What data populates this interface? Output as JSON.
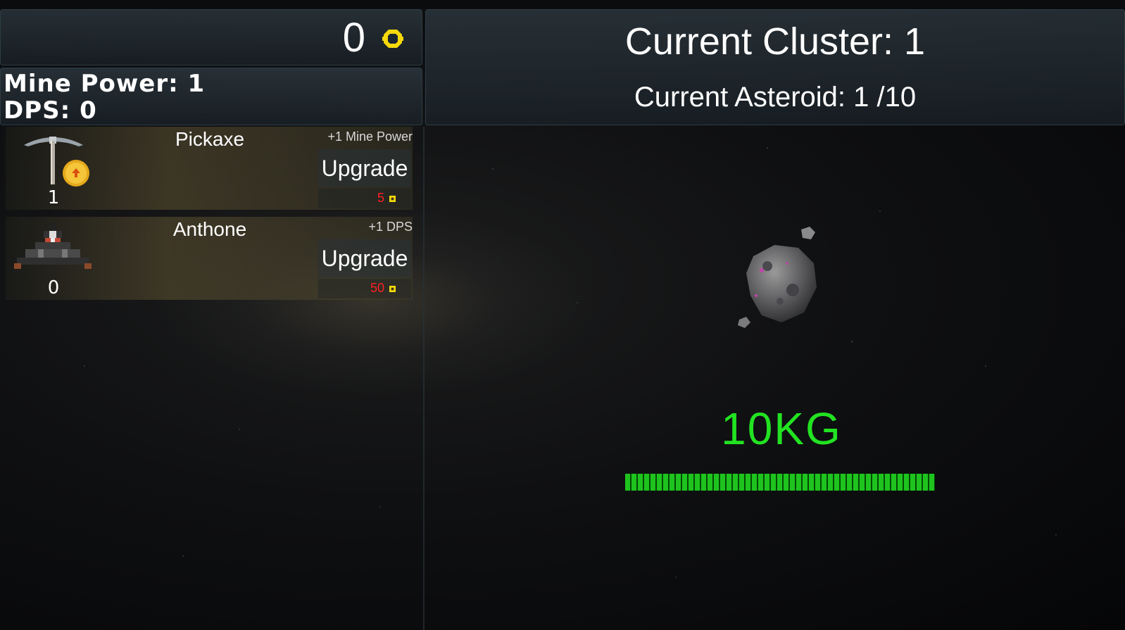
{
  "currency": {
    "amount": "0",
    "icon": "gold-coin-icon",
    "color": "#f5d90a"
  },
  "stats": {
    "mine_power": "Mine Power: 1",
    "dps": "DPS: 0"
  },
  "location": {
    "cluster": "Current Cluster: 1",
    "asteroid": "Current Asteroid: 1 /10"
  },
  "upgrades": [
    {
      "name": "Pickaxe",
      "bonus": "+1 Mine Power",
      "button": "Upgrade",
      "cost": "5",
      "level": "1",
      "icon": "pickaxe-icon"
    },
    {
      "name": "Anthone",
      "bonus": "+1 DPS",
      "button": "Upgrade",
      "cost": "50",
      "level": "0",
      "icon": "ship-icon"
    }
  ],
  "target": {
    "mass": "10KG",
    "health_fraction": 1.0,
    "bar_color": "#1ec31e",
    "icon": "asteroid-icon"
  }
}
